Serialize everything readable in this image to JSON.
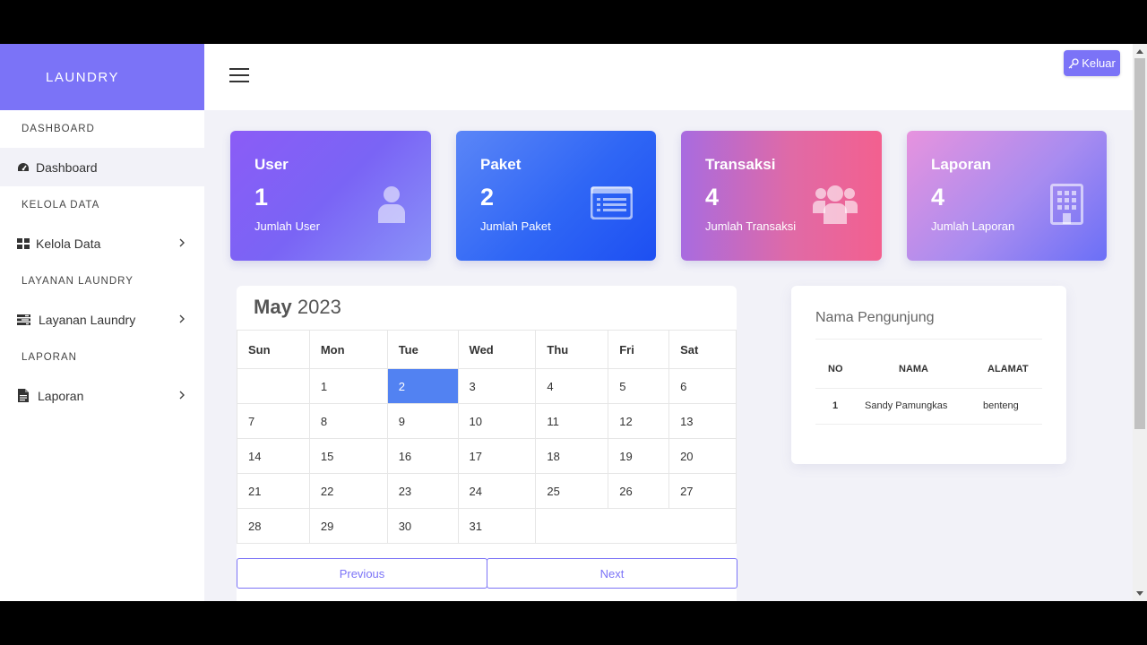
{
  "sidebar": {
    "brand": "LAUNDRY",
    "sections": [
      {
        "heading": "DASHBOARD",
        "item": "Dashboard",
        "icon": "tachometer-icon",
        "has_chevron": false
      },
      {
        "heading": "KELOLA DATA",
        "item": "Kelola Data",
        "icon": "grid-icon",
        "has_chevron": true
      },
      {
        "heading": "LAYANAN LAUNDRY",
        "item": "Layanan Laundry",
        "icon": "tasks-icon",
        "has_chevron": true
      },
      {
        "heading": "LAPORAN",
        "item": "Laporan",
        "icon": "file-icon",
        "has_chevron": true
      }
    ]
  },
  "topbar": {
    "menu_icon": "hamburger-icon",
    "logout_label": "Keluar",
    "logout_icon": "key-icon",
    "accent": "#7b73f7"
  },
  "cards": [
    {
      "title": "User",
      "value": "1",
      "subtitle": "Jumlah User",
      "icon": "user-icon"
    },
    {
      "title": "Paket",
      "value": "2",
      "subtitle": "Jumlah Paket",
      "icon": "list-card-icon"
    },
    {
      "title": "Transaksi",
      "value": "4",
      "subtitle": "Jumlah Transaksi",
      "icon": "users-icon"
    },
    {
      "title": "Laporan",
      "value": "4",
      "subtitle": "Jumlah Laporan",
      "icon": "building-icon"
    }
  ],
  "calendar": {
    "month": "May",
    "year": "2023",
    "days": [
      "Sun",
      "Mon",
      "Tue",
      "Wed",
      "Thu",
      "Fri",
      "Sat"
    ],
    "weeks": [
      [
        "",
        "1",
        "2",
        "3",
        "4",
        "5",
        "6"
      ],
      [
        "7",
        "8",
        "9",
        "10",
        "11",
        "12",
        "13"
      ],
      [
        "14",
        "15",
        "16",
        "17",
        "18",
        "19",
        "20"
      ],
      [
        "21",
        "22",
        "23",
        "24",
        "25",
        "26",
        "27"
      ],
      [
        "28",
        "29",
        "30",
        "31",
        "",
        "",
        ""
      ]
    ],
    "today": "2",
    "today_color": "#5282f2",
    "prev_label": "Previous",
    "next_label": "Next"
  },
  "visitors": {
    "title": "Nama Pengunjung",
    "columns": [
      "NO",
      "NAMA",
      "ALAMAT"
    ],
    "rows": [
      [
        "1",
        "Sandy Pamungkas",
        "benteng"
      ]
    ]
  }
}
